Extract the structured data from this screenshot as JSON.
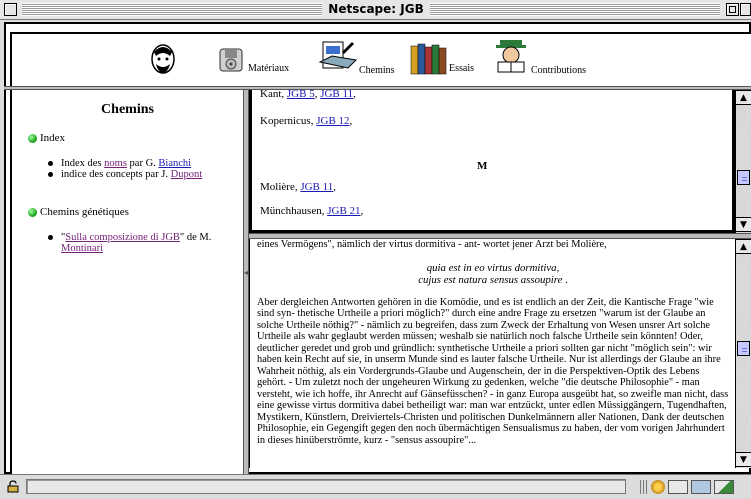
{
  "window": {
    "title": "Netscape: JGB"
  },
  "toolbar": {
    "items": [
      {
        "label": "",
        "icon": "nietzsche-portrait-icon"
      },
      {
        "label": "Matériaux",
        "icon": "floppy-disk-icon"
      },
      {
        "label": "Chemins",
        "icon": "notebook-writing-icon"
      },
      {
        "label": "Essais",
        "icon": "books-icon"
      },
      {
        "label": "Contributions",
        "icon": "reading-man-icon"
      }
    ]
  },
  "sidebar": {
    "title": "Chemins",
    "sections": [
      {
        "label": "Index",
        "items": [
          {
            "pre": "Index des ",
            "link": "noms",
            "mid": " par G. ",
            "link2": "Bianchi"
          },
          {
            "pre": "indice des concepts par J. ",
            "link": "Dupont"
          }
        ]
      },
      {
        "label": "Chemins génétiques",
        "items": [
          {
            "pre": "\"",
            "link": "Sulla composizione di JGB",
            "post": "\" de M. ",
            "link2": "Montinari"
          }
        ]
      }
    ]
  },
  "index": {
    "rows": [
      {
        "name": "Kant, ",
        "links": [
          "JGB 5",
          "JGB 11"
        ],
        "trail": ","
      },
      {
        "name": "Kopernicus, ",
        "links": [
          "JGB 12"
        ],
        "trail": ","
      },
      {
        "letter": "M"
      },
      {
        "name": "Molière, ",
        "links": [
          "JGB 11"
        ],
        "trail": ","
      },
      {
        "name": "Münchhausen, ",
        "links": [
          "JGB 21"
        ],
        "trail": ","
      }
    ]
  },
  "text": {
    "first_line": "eines Vermögens\", nämlich der virtus dormitiva - ant- wortet jener Arzt bei Molière,",
    "quote_line1": "quia est in eo virtus dormitiva,",
    "quote_line2": "cujus est natura sensus assoupire",
    "quote_tail": " .",
    "paragraph": "Aber dergleichen Antworten gehören in die Komödie, und es ist endlich an der Zeit, die Kantische Frage \"wie sind syn- thetische Urtheile a priori möglich?\" durch eine andre Frage zu ersetzen \"warum ist der Glaube an solche Urtheile nöthig?\" - nämlich zu begreifen, dass zum Zweck der Erhaltung von Wesen unsrer Art solche Urtheile als wahr geglaubt werden müssen; weshalb sie natürlich noch falsche Urtheile sein könnten! Oder, deutlicher geredet und grob und gründlich: synthetische Urtheile a priori sollten gar nicht \"möglich sein\": wir haben kein Recht auf sie, in unserm Munde sind es lauter falsche Urtheile. Nur ist allerdings der Glaube an ihre Wahrheit nöthig, als ein Vordergrunds-Glaube und Augenschein, der in die Perspektiven-Optik des Lebens gehört. - Um zuletzt noch der ungeheuren Wirkung zu gedenken, welche \"die deutsche Philosophie\" - man versteht, wie ich hoffe, ihr Anrecht auf Gänsefüsschen? - in ganz Europa ausgeübt hat, so zweifle man nicht, dass eine gewisse virtus dormitiva dabei betheiligt war: man war entzückt, unter edlen Müssiggängern, Tugendhaften, Mystikern, Künstlern, Dreiviertels-Christen und politischen Dunkelmännern aller Nationen, Dank der deutschen Philosophie, ein Gegengift gegen den noch übermächtigen Sensualismus zu haben, der vom vorigen Jahrhundert in dieses hinüberströmte, kurz - \"sensus assoupire\"..."
  },
  "colors": {
    "link": "#1a1ab4",
    "visited": "#77227a",
    "green": "#119911"
  }
}
